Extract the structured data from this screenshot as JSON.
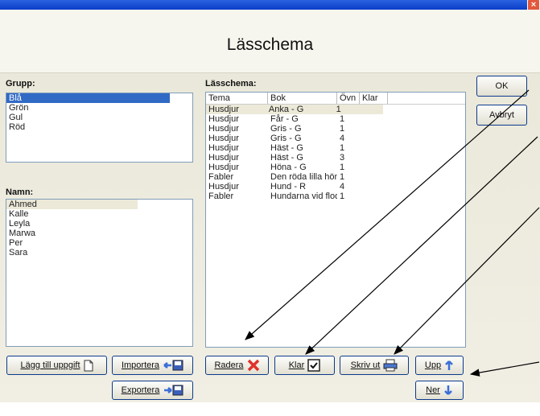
{
  "window": {
    "close_symbol": "×"
  },
  "header": {
    "title": "Lässchema"
  },
  "grupp": {
    "label": "Grupp:",
    "items": [
      "Blå",
      "Grön",
      "Gul",
      "Röd"
    ],
    "selected_index": 0
  },
  "namn": {
    "label": "Namn:",
    "items": [
      "Ahmed",
      "Kalle",
      "Leyla",
      "Marwa",
      "Per",
      "Sara"
    ],
    "focused_index": 0
  },
  "schema": {
    "label": "Lässchema:",
    "columns": [
      "Tema",
      "Bok",
      "Övn",
      "Klar"
    ],
    "rows": [
      [
        "Husdjur",
        "Anka - G",
        "1",
        ""
      ],
      [
        "Husdjur",
        "Får - G",
        "1",
        ""
      ],
      [
        "Husdjur",
        "Gris - G",
        "1",
        ""
      ],
      [
        "Husdjur",
        "Gris - G",
        "4",
        ""
      ],
      [
        "Husdjur",
        "Häst - G",
        "1",
        ""
      ],
      [
        "Husdjur",
        "Häst - G",
        "3",
        ""
      ],
      [
        "Husdjur",
        "Höna - G",
        "1",
        ""
      ],
      [
        "Fabler",
        "Den röda lilla höna...",
        "1",
        ""
      ],
      [
        "Husdjur",
        "Hund - R",
        "4",
        ""
      ],
      [
        "Fabler",
        "Hundarna vid flod...",
        "1",
        ""
      ]
    ]
  },
  "buttons": {
    "ok": "OK",
    "cancel": "Avbryt",
    "add_task": "Lägg till uppgift",
    "import": "Importera",
    "export": "Exportera",
    "delete": "Radera",
    "done": "Klar",
    "print": "Skriv ut",
    "up": "Upp",
    "down": "Ner"
  },
  "colors": {
    "selection": "#316ac5",
    "arrow": "#000000",
    "delete_icon": "#e0302a",
    "arrow_icon": "#3a6fd8"
  }
}
